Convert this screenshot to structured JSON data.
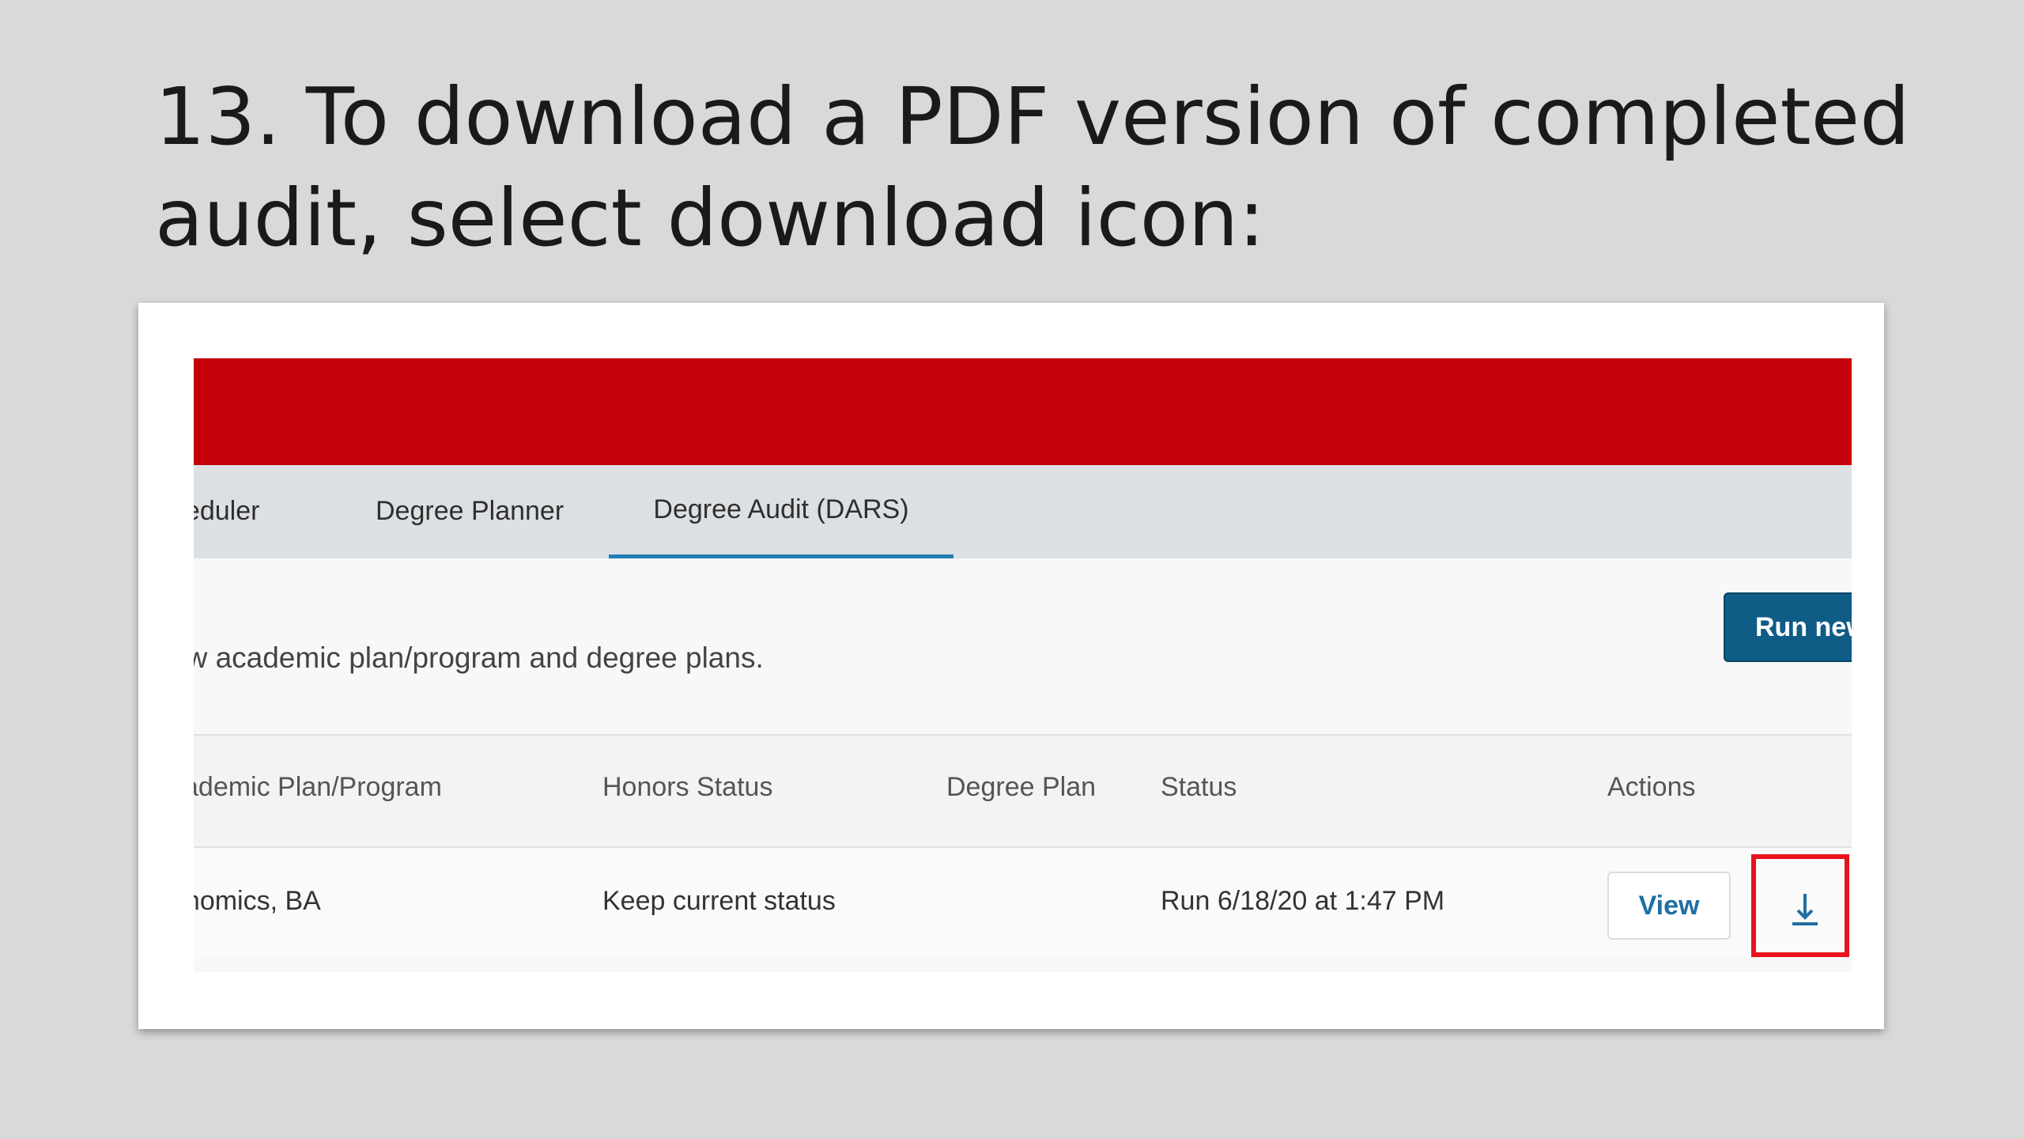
{
  "slide": {
    "title": "13.  To download a PDF version of completed audit, select download icon:"
  },
  "nav": {
    "tabs": [
      {
        "label": "heduler"
      },
      {
        "label": "Degree Planner"
      },
      {
        "label": "Degree Audit (DARS)"
      }
    ],
    "active_tab": "Degree Audit (DARS)"
  },
  "main": {
    "intro": "ew academic plan/program and degree plans.",
    "run_new_label": "Run new"
  },
  "table": {
    "headers": [
      "cademic Plan/Program",
      "Honors Status",
      "Degree Plan",
      "Status",
      "Actions"
    ],
    "rows": [
      {
        "plan": "onomics, BA",
        "honors": "Keep current status",
        "degree_plan": "",
        "status": "Run 6/18/20 at 1:47 PM",
        "view_label": "View",
        "download_icon": "download-icon"
      }
    ]
  },
  "colors": {
    "brand_red": "#c4000a",
    "nav_bg": "#dde0e3",
    "tab_underline": "#1f7fb6",
    "primary_button": "#0f5c87",
    "link_blue": "#1f6fa3",
    "highlight_box": "#e8141c"
  }
}
